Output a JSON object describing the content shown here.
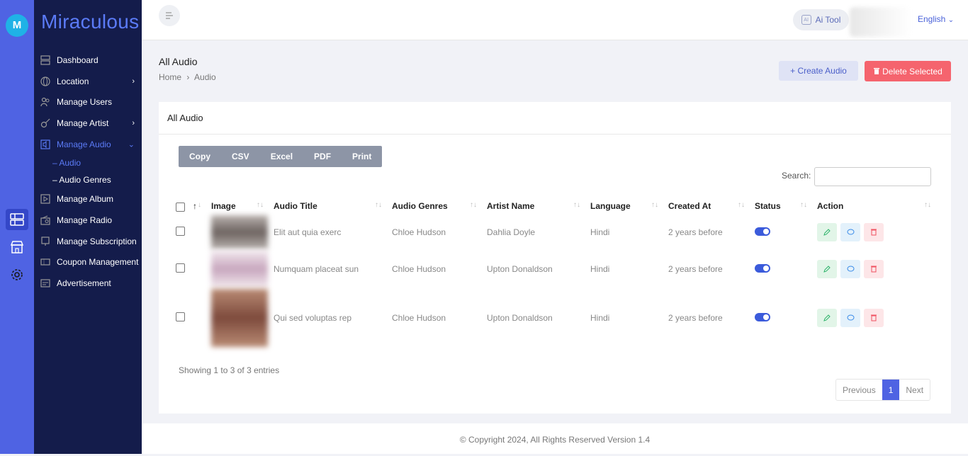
{
  "brand": {
    "logo_letter": "M",
    "name": "Miraculous"
  },
  "sidebar": {
    "items": [
      {
        "label": "Dashboard"
      },
      {
        "label": "Location",
        "chevron": "›"
      },
      {
        "label": "Manage Users"
      },
      {
        "label": "Manage Artist",
        "chevron": "›"
      },
      {
        "label": "Manage Audio",
        "chevron": "⌄"
      },
      {
        "label": "Manage Album"
      },
      {
        "label": "Manage Radio"
      },
      {
        "label": "Manage Subscription"
      },
      {
        "label": "Coupon Management"
      },
      {
        "label": "Advertisement"
      }
    ],
    "subitems": [
      {
        "label": "– Audio"
      },
      {
        "label": "– Audio Genres"
      }
    ]
  },
  "topbar": {
    "ai_tool": "Ai Tool",
    "ai_icon": "AI",
    "language": "English"
  },
  "page": {
    "title": "All Audio",
    "breadcrumb": {
      "home": "Home",
      "sep": "›",
      "current": "Audio"
    },
    "create_btn": "+  Create Audio",
    "delete_btn": "Delete Selected"
  },
  "card": {
    "title": "All Audio",
    "export_buttons": [
      "Copy",
      "CSV",
      "Excel",
      "PDF",
      "Print"
    ],
    "search_label": "Search:",
    "columns": [
      "",
      "↑",
      "Image",
      "Audio Title",
      "Audio Genres",
      "Artist Name",
      "Language",
      "Created At",
      "Status",
      "Action"
    ],
    "rows": [
      {
        "title": "Elit aut quia exerc",
        "genre": "Chloe Hudson",
        "artist": "Dahlia Doyle",
        "language": "Hindi",
        "created": "2 years before",
        "status_on": true
      },
      {
        "title": "Numquam placeat sun",
        "genre": "Chloe Hudson",
        "artist": "Upton Donaldson",
        "language": "Hindi",
        "created": "2 years before",
        "status_on": true
      },
      {
        "title": "Qui sed voluptas rep",
        "genre": "Chloe Hudson",
        "artist": "Upton Donaldson",
        "language": "Hindi",
        "created": "2 years before",
        "status_on": true
      }
    ],
    "showing": "Showing 1 to 3 of 3 entries",
    "pager": {
      "prev": "Previous",
      "current": "1",
      "next": "Next"
    }
  },
  "footer": "© Copyright 2024, All Rights Reserved Version 1.4",
  "colors": {
    "rail": "#4f63e3",
    "sidebar": "#141c4b",
    "accent": "#5b7bf7",
    "danger": "#f5646e"
  }
}
